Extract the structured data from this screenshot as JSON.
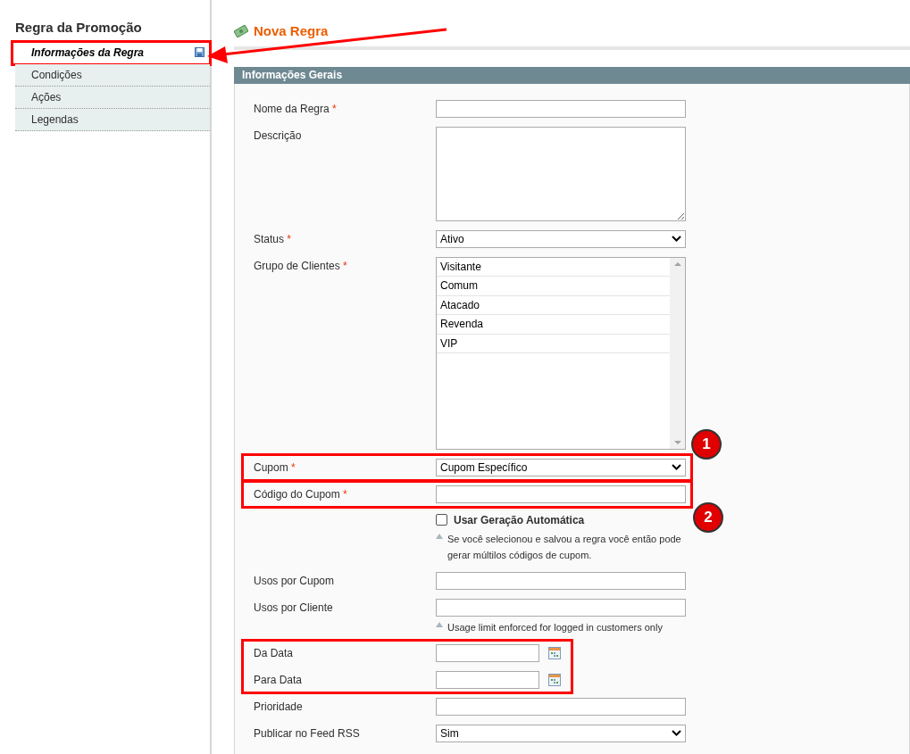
{
  "sidebar": {
    "title": "Regra da Promoção",
    "items": [
      {
        "label": "Informações da Regra",
        "selected": true,
        "highlighted": true
      },
      {
        "label": "Condições",
        "selected": false,
        "highlighted": false
      },
      {
        "label": "Ações",
        "selected": false,
        "highlighted": false
      },
      {
        "label": "Legendas",
        "selected": false,
        "highlighted": false
      }
    ]
  },
  "page": {
    "title": "Nova Regra"
  },
  "form": {
    "section_title": "Informações Gerais",
    "rows": [
      {
        "kind": "text",
        "label": "Nome da Regra",
        "required_mark": "*",
        "value": ""
      },
      {
        "kind": "textarea",
        "label": "Descrição",
        "value": ""
      },
      {
        "kind": "select",
        "label": "Status",
        "required_mark": "*",
        "value": "Ativo"
      },
      {
        "kind": "multiselect",
        "label": "Grupo de Clientes",
        "required_mark": "*",
        "options": [
          {
            "label": "Visitante",
            "selected": false
          },
          {
            "label": "Comum",
            "selected": false
          },
          {
            "label": "Atacado",
            "selected": false
          },
          {
            "label": "Revenda",
            "selected": false
          },
          {
            "label": "VIP",
            "selected": false
          }
        ]
      },
      {
        "kind": "highlight",
        "badge": "1",
        "rows": [
          {
            "kind": "select",
            "label": "Cupom",
            "required_mark": "*",
            "value": "Cupom Específico"
          }
        ]
      },
      {
        "kind": "highlight",
        "badge": "2",
        "rows": [
          {
            "kind": "text",
            "label": "Código do Cupom",
            "required_mark": "*",
            "value": ""
          }
        ]
      },
      {
        "kind": "checkbox",
        "label": "Usar Geração Automática",
        "checked": false,
        "note": "Se você selecionou e salvou a regra você então pode gerar múltilos códigos de cupom."
      },
      {
        "kind": "text",
        "label": "Usos por Cupom",
        "value": ""
      },
      {
        "kind": "text",
        "label": "Usos por Cliente",
        "value": "",
        "note": "Usage limit enforced for logged in customers only"
      },
      {
        "kind": "highlight",
        "rows": [
          {
            "kind": "date",
            "label": "Da Data",
            "value": ""
          },
          {
            "kind": "date",
            "label": "Para Data",
            "value": ""
          }
        ]
      },
      {
        "kind": "text",
        "label": "Prioridade",
        "value": ""
      },
      {
        "kind": "select",
        "label": "Publicar no Feed RSS",
        "value": "Sim"
      }
    ]
  }
}
